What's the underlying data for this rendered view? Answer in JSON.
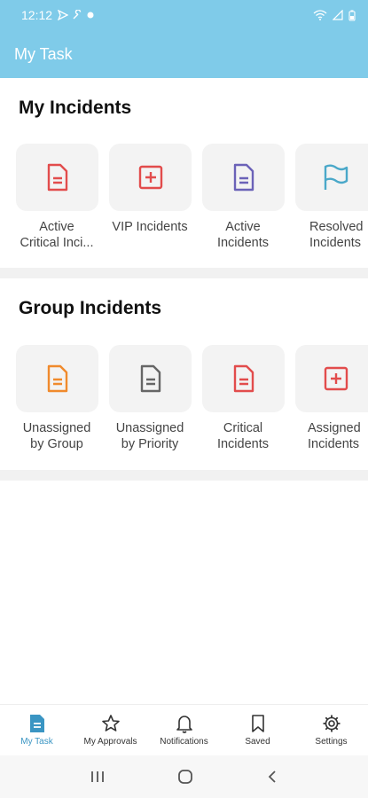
{
  "status": {
    "time": "12:12"
  },
  "appbar": {
    "title": "My Task"
  },
  "my_incidents": {
    "title": "My Incidents",
    "tiles": [
      {
        "icon": "document-icon",
        "color": "#e24c4c",
        "line1": "Active",
        "line2": "Critical Inci..."
      },
      {
        "icon": "plus-square-icon",
        "color": "#e24c4c",
        "line1": "VIP Incidents",
        "line2": ""
      },
      {
        "icon": "document-icon",
        "color": "#6b62b8",
        "line1": "Active",
        "line2": "Incidents"
      },
      {
        "icon": "flag-icon",
        "color": "#4aa8c9",
        "line1": "Resolved",
        "line2": "Incidents"
      }
    ]
  },
  "group_incidents": {
    "title": "Group Incidents",
    "tiles": [
      {
        "icon": "document-icon",
        "color": "#f08a2c",
        "line1": "Unassigned",
        "line2": "by Group"
      },
      {
        "icon": "document-icon",
        "color": "#666666",
        "line1": "Unassigned",
        "line2": "by Priority"
      },
      {
        "icon": "document-icon",
        "color": "#e24c4c",
        "line1": "Critical",
        "line2": "Incidents"
      },
      {
        "icon": "plus-square-icon",
        "color": "#e24c4c",
        "line1": "Assigned",
        "line2": "Incidents"
      }
    ]
  },
  "bottom_nav": {
    "items": [
      {
        "label": "My Task",
        "icon": "task-icon"
      },
      {
        "label": "My Approvals",
        "icon": "star-icon"
      },
      {
        "label": "Notifications",
        "icon": "bell-icon"
      },
      {
        "label": "Saved",
        "icon": "bookmark-icon"
      },
      {
        "label": "Settings",
        "icon": "gear-icon"
      }
    ]
  },
  "colors": {
    "accent": "#7fcbe9",
    "active_nav": "#3a95c3"
  }
}
